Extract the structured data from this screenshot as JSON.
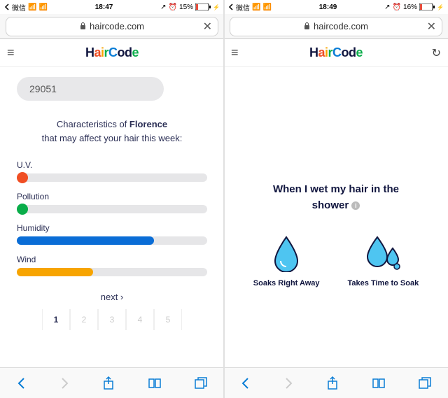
{
  "left": {
    "status": {
      "carrier": "微信",
      "signal": "ıl",
      "time": "18:47",
      "battery": "15%"
    },
    "url": {
      "domain": "haircode.com"
    },
    "logo": {
      "h": "H",
      "a": "a",
      "i": "i",
      "r": "r",
      "c": "C",
      "o": "o",
      "d": "d",
      "e": "e"
    },
    "zip": "29051",
    "char_prefix": "Characteristics of ",
    "char_city": "Florence",
    "char_mid": " that may affect your hair this week:",
    "meters": [
      {
        "label": "U.V.",
        "color": "#f04e23",
        "width": "6%",
        "dot": true
      },
      {
        "label": "Pollution",
        "color": "#0aad4a",
        "width": "6%",
        "dot": true
      },
      {
        "label": "Humidity",
        "color": "#0a6dd6",
        "width": "72%",
        "dot": false
      },
      {
        "label": "Wind",
        "color": "#f7a400",
        "width": "40%",
        "dot": false
      }
    ],
    "next": "next ›",
    "pages": [
      "1",
      "2",
      "3",
      "4",
      "5"
    ]
  },
  "right": {
    "status": {
      "carrier": "微信",
      "signal": "ıl",
      "time": "18:49",
      "battery": "16%"
    },
    "url": {
      "domain": "haircode.com"
    },
    "question_l1": "When I wet my hair in the",
    "question_l2": "shower",
    "options": [
      {
        "label": "Soaks Right Away"
      },
      {
        "label": "Takes Time to Soak"
      }
    ]
  }
}
